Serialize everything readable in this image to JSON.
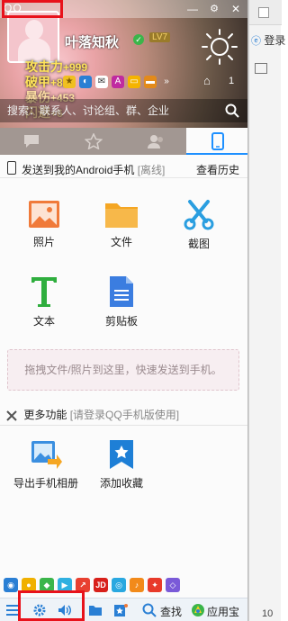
{
  "browser": {
    "login_label": "登录",
    "bottom_text": "10"
  },
  "header": {
    "nickname": "叶落知秋",
    "vip_badge": "LV7",
    "stats": [
      {
        "label": "攻击力",
        "value": "+999"
      },
      {
        "label": "破甲",
        "value": "+82"
      },
      {
        "label": "暴伤",
        "value": "+453"
      },
      {
        "label": "闪避",
        "value": "+6"
      }
    ],
    "message_count": "1",
    "search_placeholder": "搜索：联系人、讨论组、群、企业"
  },
  "tabs": [
    {
      "name": "tab-conversations",
      "icon": "chat-bubble-icon"
    },
    {
      "name": "tab-favorites",
      "icon": "star-icon"
    },
    {
      "name": "tab-contacts",
      "icon": "contacts-icon"
    },
    {
      "name": "tab-device",
      "icon": "phone-icon",
      "active": true
    }
  ],
  "device": {
    "send_to_label": "发送到我的Android手机",
    "status": "[离线]",
    "history_link": "查看历史"
  },
  "actions": {
    "photo": "照片",
    "file": "文件",
    "screenshot": "截图",
    "text": "文本",
    "clipboard": "剪贴板"
  },
  "drop_zone_text": "拖拽文件/照片到这里，快速发送到手机。",
  "more": {
    "title": "更多功能",
    "subtitle": "[请登录QQ手机版使用]",
    "export_album": "导出手机相册",
    "add_favorite": "添加收藏"
  },
  "bottom": {
    "search_label": "查找",
    "app_center_label": "应用宝"
  },
  "colors": {
    "accent": "#1e90ff",
    "highlight_frame": "#e8121b",
    "folder": "#f5a623",
    "photo": "#f07a3a",
    "scissors": "#2a9ee0",
    "text_icon": "#2fae3e",
    "doc_icon": "#3b7de0"
  }
}
